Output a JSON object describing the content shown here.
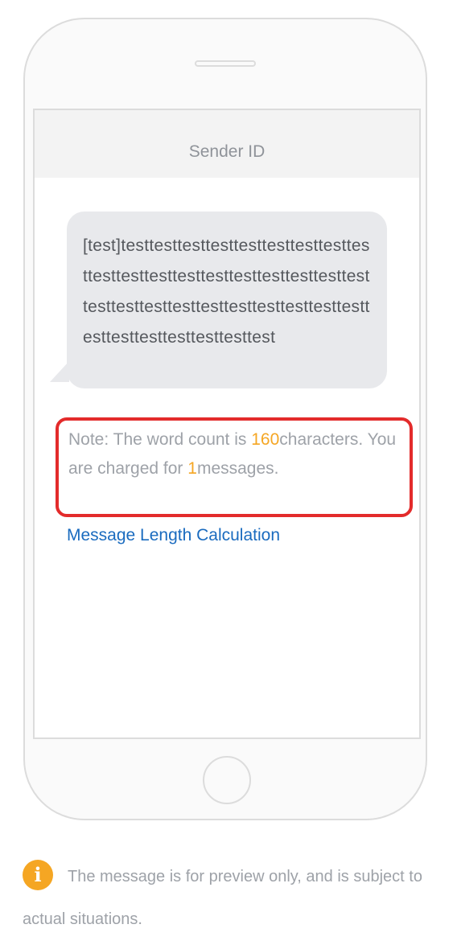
{
  "preview": {
    "header_title": "Sender ID",
    "message_text": "[test]testtesttesttesttesttesttesttesttesttesttesttesttesttesttesttesttesttesttesttesttesttesttesttesttesttesttesttesttesttesttesttesttesttesttesttest",
    "note": {
      "prefix": "Note: The word count is ",
      "char_count": "160",
      "middle": "characters. You are charged for ",
      "message_count": "1",
      "suffix": "messages."
    },
    "calc_link_label": "Message Length Calculation"
  },
  "footer": {
    "icon": "info-icon",
    "icon_glyph": "i",
    "text": "The message is for preview only, and is subject to actual situations."
  },
  "colors": {
    "accent_orange": "#f5a623",
    "link_blue": "#1a6bbf",
    "highlight_border_red": "#e32b2b"
  }
}
